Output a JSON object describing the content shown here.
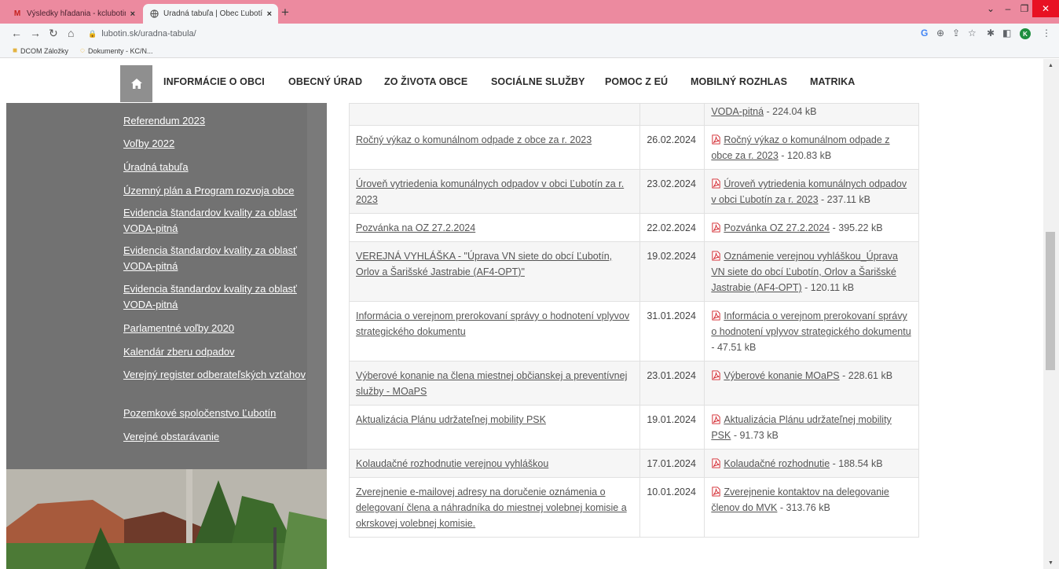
{
  "browser": {
    "tabs": [
      {
        "title": "Výsledky hľadania - kclubotin@…",
        "active": false
      },
      {
        "title": "Úradná tabuľa | Obec Ľubotín",
        "active": true
      }
    ],
    "url": "lubotin.sk/uradna-tabula/",
    "profile_initial": "K",
    "bookmarks": [
      "DCOM Záložky",
      "Dokumenty - KC/N..."
    ]
  },
  "nav": {
    "items": [
      "INFORMÁCIE O OBCI",
      "OBECNÝ ÚRAD",
      "ZO ŽIVOTA OBCE",
      "SOCIÁLNE SLUŽBY",
      "POMOC Z EÚ",
      "MOBILNÝ ROZHLAS",
      "MATRIKA"
    ]
  },
  "sidebar": {
    "links": [
      "Referendum 2023",
      "Voľby 2022",
      "Úradná tabuľa",
      "Územný plán a Program rozvoja obce",
      "Evidencia štandardov kvality za oblasť VODA-pitná",
      "Evidencia štandardov kvality za oblasť VODA-pitná",
      "Evidencia štandardov kvality za oblasť VODA-pitná",
      "Parlamentné voľby 2020",
      "Kalendár zberu odpadov",
      "Verejný register odberateľských vzťahov",
      "Pozemkové spoločenstvo Ľubotín",
      "Verejné obstarávanie"
    ]
  },
  "table": {
    "rows": [
      {
        "title": "",
        "date": "",
        "file_link": "VODA-pitná",
        "file_size": " - 224.04 kB",
        "has_icon": false
      },
      {
        "title": "Ročný výkaz o komunálnom odpade z obce za r. 2023",
        "date": "26.02.2024",
        "file_link": "Ročný výkaz o komunálnom odpade z obce za r. 2023",
        "file_size": " - 120.83 kB",
        "has_icon": true
      },
      {
        "title": "Úroveň vytriedenia komunálnych odpadov v obci Ľubotín za r. 2023",
        "date": "23.02.2024",
        "file_link": "Úroveň vytriedenia komunálnych odpadov v obci Ľubotín za r. 2023",
        "file_size": " - 237.11 kB",
        "has_icon": true
      },
      {
        "title": "Pozvánka na OZ 27.2.2024",
        "date": "22.02.2024",
        "file_link": "Pozvánka OZ 27.2.2024",
        "file_size": " - 395.22 kB",
        "has_icon": true
      },
      {
        "title": "VEREJNÁ VYHLÁŠKA - \"Úprava VN siete do obcí Ľubotín, Orlov a Šarišské Jastrabie (AF4-OPT)\"",
        "date": "19.02.2024",
        "file_link": "Oznámenie verejnou vyhláškou_Úprava VN siete do obcí Ľubotín, Orlov a Šarišské Jastrabie (AF4-OPT)",
        "file_size": " - 120.11 kB",
        "has_icon": true
      },
      {
        "title": "Informácia o verejnom prerokovaní správy o hodnotení vplyvov strategického dokumentu",
        "date": "31.01.2024",
        "file_link": "Informácia o verejnom prerokovaní správy o hodnotení vplyvov strategického dokumentu",
        "file_size": " - 47.51 kB",
        "has_icon": true
      },
      {
        "title": "Výberové konanie na člena miestnej občianskej a preventívnej služby - MOaPS",
        "date": "23.01.2024",
        "file_link": "Výberové konanie MOaPS",
        "file_size": " - 228.61 kB",
        "has_icon": true
      },
      {
        "title": "Aktualizácia Plánu udržateľnej mobility PSK",
        "date": "19.01.2024",
        "file_link": "Aktualizácia Plánu udržateľnej mobility PSK",
        "file_size": " - 91.73 kB",
        "has_icon": true
      },
      {
        "title": "Kolaudačné rozhodnutie verejnou vyhláškou",
        "date": "17.01.2024",
        "file_link": "Kolaudačné rozhodnutie",
        "file_size": " - 188.54 kB",
        "has_icon": true
      },
      {
        "title": "Zverejnenie e-mailovej adresy na doručenie oznámenia o delegovaní člena a náhradníka do miestnej volebnej komisie a okrskovej volebnej komisie.",
        "date": "10.01.2024",
        "file_link": "Zverejnenie kontaktov na delegovanie členov do MVK",
        "file_size": " - 313.76 kB",
        "has_icon": true
      }
    ]
  },
  "colors": {
    "tabstrip": "#ec8a9f",
    "sidebar": "#727272",
    "home_button": "#8f8f8f",
    "pdf_icon": "#d2232a"
  }
}
